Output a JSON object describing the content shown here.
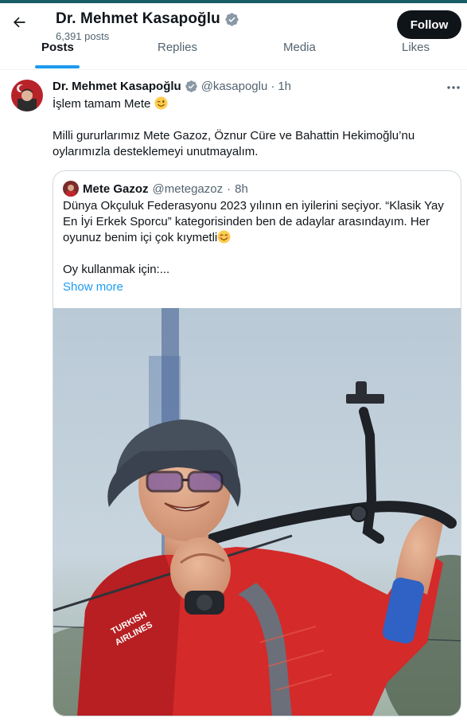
{
  "header": {
    "name": "Dr. Mehmet Kasapoğlu",
    "posts_count": "6,391 posts",
    "follow_label": "Follow",
    "verified_color": "#8b98a5"
  },
  "tabs": [
    {
      "label": "Posts",
      "active": true
    },
    {
      "label": "Replies",
      "active": false
    },
    {
      "label": "Media",
      "active": false
    },
    {
      "label": "Likes",
      "active": false
    }
  ],
  "tweet": {
    "author_name": "Dr. Mehmet Kasapoğlu",
    "author_handle": "@kasapoglu",
    "time": "1h",
    "dot": "·",
    "line1": "İşlem tamam Mete",
    "line1_emoji": "winking-face",
    "body": "Milli gururlarımız Mete Gazoz, Öznur Cüre ve Bahattin Hekimoğlu’nu oylarımızla desteklemeyi unutmayalım."
  },
  "quote": {
    "author_name": "Mete Gazoz",
    "author_handle": "@metegazoz",
    "time": "8h",
    "dot": "·",
    "text_part1": "Dünya Okçuluk Federasyonu 2023 yılının en iyilerini seçiyor. “Klasik Yay En İyi Erkek Sporcu” kategorisinden ben de adaylar arasındayım. Her oyunuz benim içi çok kıymetli",
    "text_emoji": "smiling-face",
    "text_part2": "Oy kullanmak için:...",
    "show_more": "Show more",
    "photo": "archer-in-red-jersey-holding-bow"
  },
  "colors": {
    "accent": "#1d9bf0",
    "text_primary": "#0f1419",
    "text_secondary": "#536471",
    "border": "#cfd9de"
  }
}
